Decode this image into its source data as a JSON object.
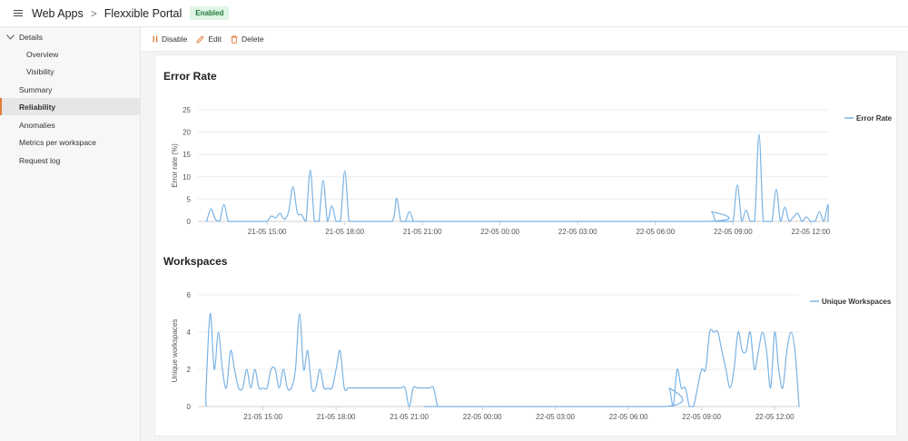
{
  "header": {
    "breadcrumb_root": "Web Apps",
    "separator": ">",
    "title": "Flexxible Portal",
    "status_badge": "Enabled"
  },
  "sidebar": {
    "group_label": "Details",
    "items": [
      {
        "label": "Overview"
      },
      {
        "label": "Visibility"
      },
      {
        "label": "Summary"
      },
      {
        "label": "Reliability"
      },
      {
        "label": "Anomalies"
      },
      {
        "label": "Metrics per workspace"
      },
      {
        "label": "Request log"
      }
    ],
    "active_item": "Reliability"
  },
  "toolbar": {
    "disable_label": "Disable",
    "edit_label": "Edit",
    "delete_label": "Delete"
  },
  "colors": {
    "accent": "#e07a3a",
    "series": "#7ab3e3",
    "badge_bg": "#dff4e5",
    "badge_text": "#1f7a3a"
  },
  "chart_data": [
    {
      "type": "line",
      "title": "Error Rate",
      "ylabel": "Error rate (%)",
      "xlabel": "",
      "ylim": [
        0,
        25
      ],
      "yticks": [
        0,
        5,
        10,
        15,
        20,
        25
      ],
      "xlim_hours": [
        12.33,
        36.67
      ],
      "xticks": [
        "21-05 15:00",
        "21-05 18:00",
        "21-05 21:00",
        "22-05 00:00",
        "22-05 03:00",
        "22-05 06:00",
        "22-05 09:00",
        "22-05 12:00"
      ],
      "legend_position": "top-right",
      "grid": true,
      "series": [
        {
          "name": "Error Rate",
          "x": [
            "21-05 12:40",
            "21-05 12:50",
            "21-05 13:00",
            "21-05 13:10",
            "21-05 13:20",
            "21-05 13:30",
            "21-05 13:40",
            "21-05 13:50",
            "21-05 14:00",
            "21-05 15:00",
            "21-05 15:10",
            "21-05 15:20",
            "21-05 15:30",
            "21-05 15:40",
            "21-05 15:50",
            "21-05 16:00",
            "21-05 16:10",
            "21-05 16:20",
            "21-05 16:30",
            "21-05 16:40",
            "21-05 16:50",
            "21-05 17:00",
            "21-05 17:10",
            "21-05 17:20",
            "21-05 17:30",
            "21-05 17:40",
            "21-05 17:50",
            "21-05 18:00",
            "21-05 18:10",
            "21-05 18:20",
            "21-05 18:30",
            "21-05 18:40",
            "21-05 18:50",
            "21-05 19:00",
            "21-05 20:00",
            "21-05 20:10",
            "21-05 20:20",
            "21-05 20:30",
            "21-05 20:40",
            "21-05 20:50",
            "21-05 21:00",
            "22-05 08:10",
            "22-05 08:20",
            "22-05 08:30",
            "22-05 08:40",
            "22-05 08:50",
            "22-05 09:00",
            "22-05 09:10",
            "22-05 09:20",
            "22-05 09:30",
            "22-05 09:40",
            "22-05 09:50",
            "22-05 10:00",
            "22-05 10:10",
            "22-05 10:20",
            "22-05 10:30",
            "22-05 10:40",
            "22-05 10:50",
            "22-05 11:00",
            "22-05 11:10",
            "22-05 11:20",
            "22-05 11:30",
            "22-05 11:40",
            "22-05 11:50",
            "22-05 12:00",
            "22-05 12:10",
            "22-05 12:20",
            "22-05 12:30",
            "22-05 12:40",
            "22-05 12:50",
            "22-05 13:00",
            "22-05 13:10",
            "22-05 13:20",
            "22-05 13:30",
            "22-05 13:40",
            "22-05 13:50",
            "22-05 14:00",
            "22-05 14:10",
            "22-05 14:20",
            "22-05 14:30",
            "22-05 14:40",
            "22-05 14:50",
            "22-05 15:00",
            "22-05 15:10",
            "22-05 15:20"
          ],
          "y": [
            0,
            2.8,
            0.5,
            0,
            3.8,
            0,
            0,
            0,
            0,
            0,
            1.2,
            0.8,
            1.8,
            0.5,
            2.2,
            7.8,
            2,
            1.5,
            0,
            11.5,
            0,
            0,
            9.2,
            0,
            3.5,
            0,
            0,
            11.3,
            0,
            0,
            0,
            0,
            0,
            0,
            5.2,
            0,
            0,
            2.2,
            0,
            0,
            0,
            2.2,
            0,
            0,
            0,
            0,
            0,
            8.2,
            0,
            2.5,
            0,
            0,
            19.5,
            0,
            0,
            0,
            7.2,
            0,
            3.2,
            0,
            1,
            1.8,
            0,
            1,
            0,
            0,
            2.2,
            0,
            3.8,
            0,
            0,
            0,
            0,
            0,
            0,
            0,
            0,
            0,
            0,
            0,
            0,
            0,
            0,
            0,
            0
          ]
        }
      ]
    },
    {
      "type": "line",
      "title": "Workspaces",
      "ylabel": "Unique workspaces",
      "xlabel": "",
      "ylim": [
        0,
        6
      ],
      "yticks": [
        0,
        2,
        4,
        6
      ],
      "xlim_hours": [
        12.33,
        37.0
      ],
      "xticks": [
        "21-05 15:00",
        "21-05 18:00",
        "21-05 21:00",
        "22-05 00:00",
        "22-05 03:00",
        "22-05 06:00",
        "22-05 09:00",
        "22-05 12:00"
      ],
      "legend_position": "top-right",
      "grid": true,
      "series": [
        {
          "name": "Unique Workspaces",
          "x": [
            "21-05 12:40",
            "21-05 12:50",
            "21-05 13:00",
            "21-05 13:10",
            "21-05 13:20",
            "21-05 13:30",
            "21-05 13:40",
            "21-05 13:50",
            "21-05 14:00",
            "21-05 14:10",
            "21-05 14:20",
            "21-05 14:30",
            "21-05 14:40",
            "21-05 14:50",
            "21-05 15:00",
            "21-05 15:10",
            "21-05 15:20",
            "21-05 15:30",
            "21-05 15:40",
            "21-05 15:50",
            "21-05 16:00",
            "21-05 16:10",
            "21-05 16:20",
            "21-05 16:30",
            "21-05 16:40",
            "21-05 16:50",
            "21-05 17:00",
            "21-05 17:10",
            "21-05 17:20",
            "21-05 17:30",
            "21-05 17:40",
            "21-05 17:50",
            "21-05 18:00",
            "21-05 18:10",
            "21-05 18:20",
            "21-05 18:30",
            "21-05 18:40",
            "21-05 18:50",
            "21-05 19:00",
            "21-05 19:10",
            "21-05 19:20",
            "21-05 19:30",
            "21-05 19:40",
            "21-05 19:50",
            "21-05 20:00",
            "21-05 20:10",
            "21-05 20:20",
            "21-05 20:30",
            "21-05 20:40",
            "21-05 20:50",
            "21-05 21:00",
            "21-05 21:10",
            "21-05 21:20",
            "21-05 21:30",
            "21-05 21:40",
            "21-05 21:50",
            "21-05 22:00",
            "21-05 22:10",
            "22-05 07:40",
            "22-05 07:50",
            "22-05 08:00",
            "22-05 08:10",
            "22-05 08:20",
            "22-05 08:30",
            "22-05 08:40",
            "22-05 08:50",
            "22-05 09:00",
            "22-05 09:10",
            "22-05 09:20",
            "22-05 09:30",
            "22-05 09:40",
            "22-05 09:50",
            "22-05 10:00",
            "22-05 10:10",
            "22-05 10:20",
            "22-05 10:30",
            "22-05 10:40",
            "22-05 10:50",
            "22-05 11:00",
            "22-05 11:10",
            "22-05 11:20",
            "22-05 11:30",
            "22-05 11:40",
            "22-05 11:50",
            "22-05 12:00",
            "22-05 12:10",
            "22-05 12:20",
            "22-05 12:30",
            "22-05 12:40",
            "22-05 12:50",
            "22-05 13:00"
          ],
          "y": [
            1,
            5,
            2,
            4,
            2,
            1,
            3,
            2,
            1,
            1,
            2,
            1,
            2,
            1,
            1,
            1,
            2,
            2,
            1,
            2,
            1,
            1,
            2,
            5,
            2,
            3,
            1,
            1,
            2,
            1,
            1,
            1,
            2,
            3,
            1,
            1,
            1,
            1,
            1,
            1,
            1,
            1,
            1,
            1,
            1,
            1,
            1,
            1,
            1,
            1,
            0,
            1,
            1,
            1,
            1,
            1,
            1,
            0,
            1,
            0,
            2,
            1,
            1,
            0,
            0,
            1,
            2,
            2,
            4,
            4,
            4,
            3,
            2,
            1,
            2,
            4,
            3,
            3,
            4,
            2,
            3,
            4,
            3,
            1,
            4,
            2,
            1,
            3,
            4,
            3,
            0
          ]
        }
      ]
    }
  ]
}
